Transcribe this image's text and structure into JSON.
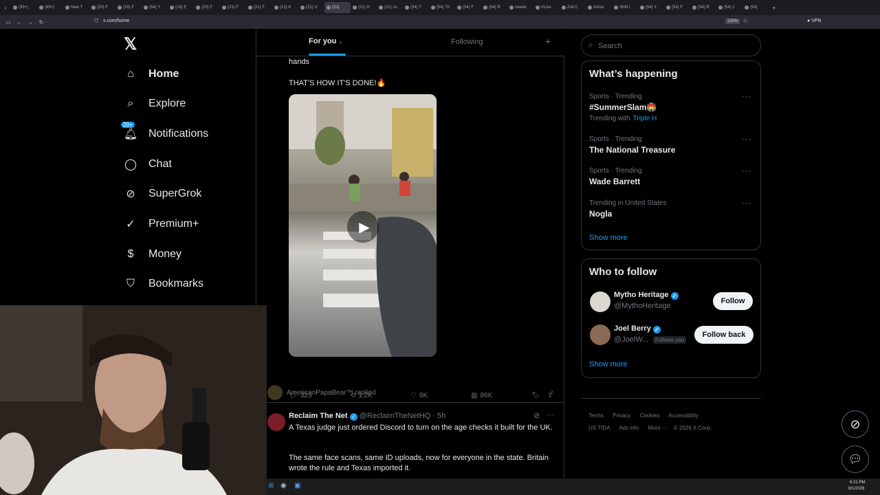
{
  "browser": {
    "tabs": [
      "(99+)",
      "(99+)",
      "New T",
      "(20) F",
      "(20) F",
      "(54) Y",
      "(16) E",
      "(20) F",
      "(21) F",
      "(21) F",
      "(21) K",
      "(21) V",
      "(21)",
      "(21) H",
      "(21) Ju",
      "(54) Y",
      "(54) Th",
      "(54) F",
      "(54) R",
      "neede",
      "r/Live",
      "Zoll C",
      "Asmo",
      "Shift I",
      "(54) Y",
      "(54) F",
      "(54) R",
      "(54) J",
      "(54)"
    ],
    "active_tab_index": 12,
    "url": "x.com/home",
    "zoom": "150%",
    "vpn": "VPN"
  },
  "nav": {
    "items": [
      {
        "label": "Home",
        "icon": "home-icon"
      },
      {
        "label": "Explore",
        "icon": "search-icon"
      },
      {
        "label": "Notifications",
        "icon": "bell-icon",
        "badge": "20+"
      },
      {
        "label": "Chat",
        "icon": "chat-icon"
      },
      {
        "label": "SuperGrok",
        "icon": "grok-icon"
      },
      {
        "label": "Premium+",
        "icon": "verified-icon"
      },
      {
        "label": "Money",
        "icon": "dollar-icon"
      },
      {
        "label": "Bookmarks",
        "icon": "bookmark-icon"
      }
    ]
  },
  "feed": {
    "tabs": {
      "for_you": "For you",
      "following": "Following"
    },
    "post1": {
      "text_tail": "hands",
      "text2": "THAT'S HOW IT'S DONE!🔥",
      "stats": {
        "replies": "325",
        "reposts": "1.2K",
        "likes": "6K",
        "views": "86K"
      }
    },
    "replied": {
      "who": "AmericanPapaBear™ replied"
    },
    "post2": {
      "name": "Reclaim The Net",
      "handle": "@ReclaimTheNetHQ",
      "time": "· 5h",
      "text1": "A Texas judge just ordered Discord to turn on the age checks it built for the UK.",
      "text2": "The same face scans, same ID uploads, now for everyone in the state. Britain wrote the rule and Texas imported it."
    }
  },
  "right": {
    "search_placeholder": "Search",
    "happening_title": "What’s happening",
    "trends": [
      {
        "category": "Sports · Trending",
        "name": "#SummerSlam🏟️",
        "extra_label": "Trending with",
        "extra_link": "Triple H"
      },
      {
        "category": "Sports · Trending",
        "name": "The National Treasure"
      },
      {
        "category": "Sports · Trending",
        "name": "Wade Barrett"
      },
      {
        "category": "Trending in United States",
        "name": "Nogla"
      }
    ],
    "show_more": "Show more",
    "follow_title": "Who to follow",
    "follow": [
      {
        "name": "Mytho Heritage",
        "handle": "@MythoHeritage",
        "button": "Follow"
      },
      {
        "name": "Joel Berry",
        "handle": "@JoelW...",
        "badge": "Follows you",
        "button": "Follow back"
      }
    ],
    "follow_show_more": "Show more",
    "footer": [
      "Terms",
      "Privacy",
      "Cookies",
      "Accessibility",
      "US TIDA",
      "Ads info",
      "More ···",
      "© 2026 X Corp."
    ]
  },
  "taskbar": {
    "time": "6:21 PM",
    "date": "8/1/2026"
  }
}
